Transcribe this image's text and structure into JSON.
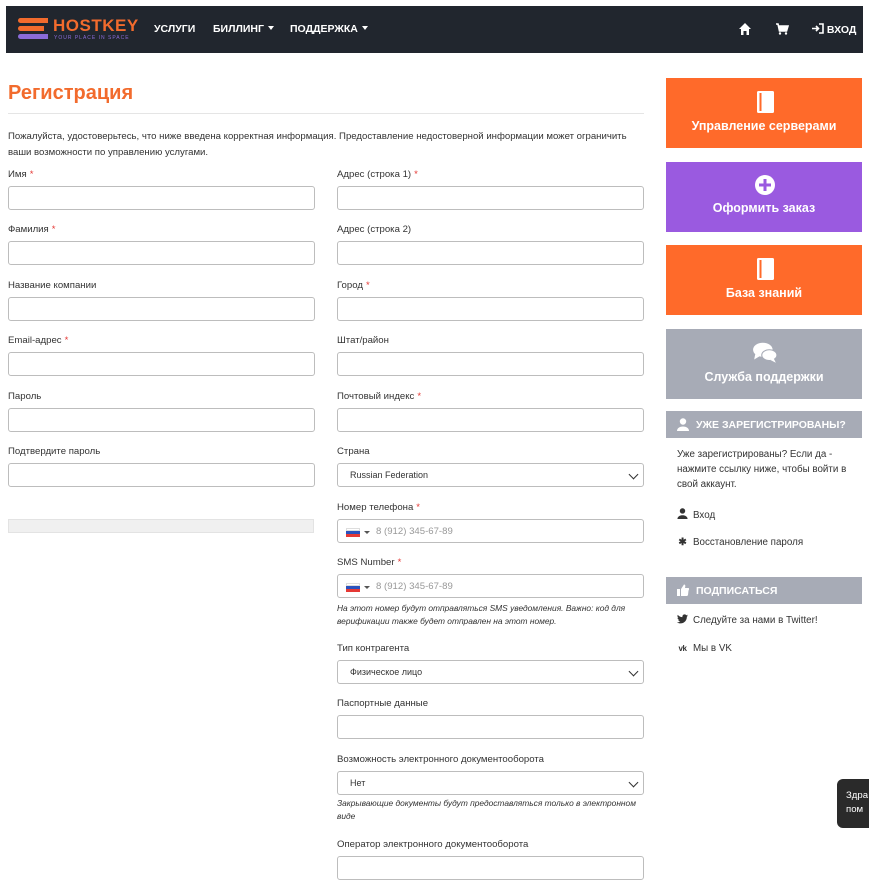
{
  "header": {
    "logo_text": "HOSTKEY",
    "logo_tagline": "YOUR PLACE IN SPACE",
    "nav": {
      "services": "УСЛУГИ",
      "billing": "БИЛЛИНГ",
      "support": "ПОДДЕРЖКА"
    },
    "login_label": "ВХОД"
  },
  "page": {
    "title": "Регистрация",
    "intro": "Пожалуйста, удостоверьтесь, что ниже введена корректная информация. Предоставление недостоверной информации может ограничить ваши возможности по управлению услугами."
  },
  "form": {
    "first_name": "Имя",
    "last_name": "Фамилия",
    "company": "Название компании",
    "email": "Email-адрес",
    "password": "Пароль",
    "password_confirm": "Подтвердите пароль",
    "address1": "Адрес (строка 1)",
    "address2": "Адрес (строка 2)",
    "city": "Город",
    "state": "Штат/район",
    "postcode": "Почтовый индекс",
    "country": "Страна",
    "country_value": "Russian Federation",
    "phone": "Номер телефона",
    "phone_placeholder": "8 (912) 345-67-89",
    "sms": "SMS Number",
    "sms_placeholder": "8 (912) 345-67-89",
    "sms_help": "На этот номер будут отправляться SMS уведомления. Важно: код для верификации также будет отправлен на этот номер.",
    "contractor_type": "Тип контрагента",
    "contractor_value": "Физическое лицо",
    "passport": "Паспортные данные",
    "edo": "Возможность электронного документооборота",
    "edo_value": "Нет",
    "edo_help": "Закрывающие документы будут предоставляться только в электронном виде",
    "edo_operator": "Оператор электронного документооборота",
    "required_mark": "*"
  },
  "sidebar": {
    "tiles": {
      "servers": "Управление серверами",
      "order": "Оформить заказ",
      "kb": "База знаний",
      "support": "Служба поддержки"
    },
    "registered": {
      "title": "УЖЕ ЗАРЕГИСТРИРОВАНЫ?",
      "text": "Уже зарегистрированы? Если да - нажмите ссылку ниже, чтобы войти в свой аккаунт.",
      "login": "Вход",
      "reset": "Восстановление пароля"
    },
    "subscribe": {
      "title": "ПОДПИСАТЬСЯ",
      "twitter": "Следуйте за нами в Twitter!",
      "vk": "Мы в VK"
    }
  },
  "chat": {
    "line1": "Здра",
    "line2": "пом"
  },
  "colors": {
    "accent": "#f26b2d",
    "purple": "#9a5ae0",
    "grey": "#a7abb6",
    "navbar": "#21262e"
  },
  "icons": [
    "home-icon",
    "cart-icon",
    "login-icon",
    "book-icon",
    "plus-circle-icon",
    "chat-bubbles-icon",
    "user-icon",
    "asterisk-icon",
    "thumbs-up-icon",
    "twitter-icon",
    "vk-icon",
    "chevron-down-icon",
    "russia-flag-icon"
  ]
}
